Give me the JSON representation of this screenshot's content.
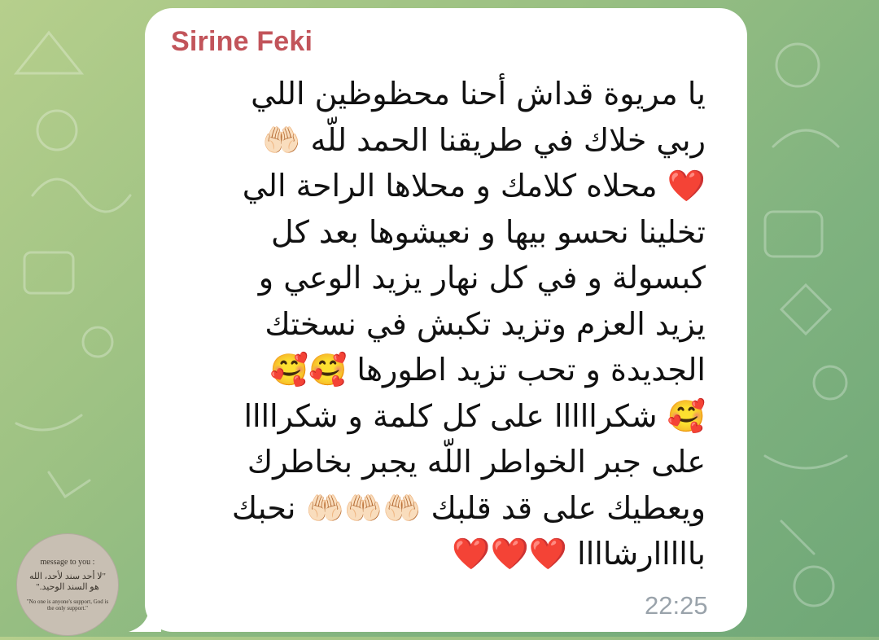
{
  "chat": {
    "sender_name": "Sirine Feki",
    "message_text": "يا مريوة قداش أحنا محظوظين اللي\nربي خلاك في طريقنا الحمد للّه 🤲🏻\n❤️ محلاه كلامك و محلاها الراحة الي\nتخلينا نحسو بيها و نعيشوها بعد كل\nكبسولة و في كل نهار يزيد الوعي و\nيزيد العزم وتزيد تكبش في نسختك\nالجديدة و تحب تزيد اطورها 🥰🥰\n🥰 شكرااااا على كل كلمة و شكراااا\nعلى جبر الخواطر اللّه يجبر بخاطرك\nويعطيك على قد قلبك 🤲🏻🤲🏻🤲🏻 نحبك\nبااااارشاااا ❤️❤️❤️",
    "timestamp": "22:25"
  },
  "avatar": {
    "line1": "message to you :",
    "line2": "\"لا أحد سند لأحد، الله\nهو السند الوحيد.\"",
    "line3": "\"No one is anyone's support, God is the only support.\""
  },
  "colors": {
    "sender": "#c2545a",
    "timestamp": "#9aa3ab",
    "bubble": "#ffffff",
    "background": "#8fbb82"
  }
}
